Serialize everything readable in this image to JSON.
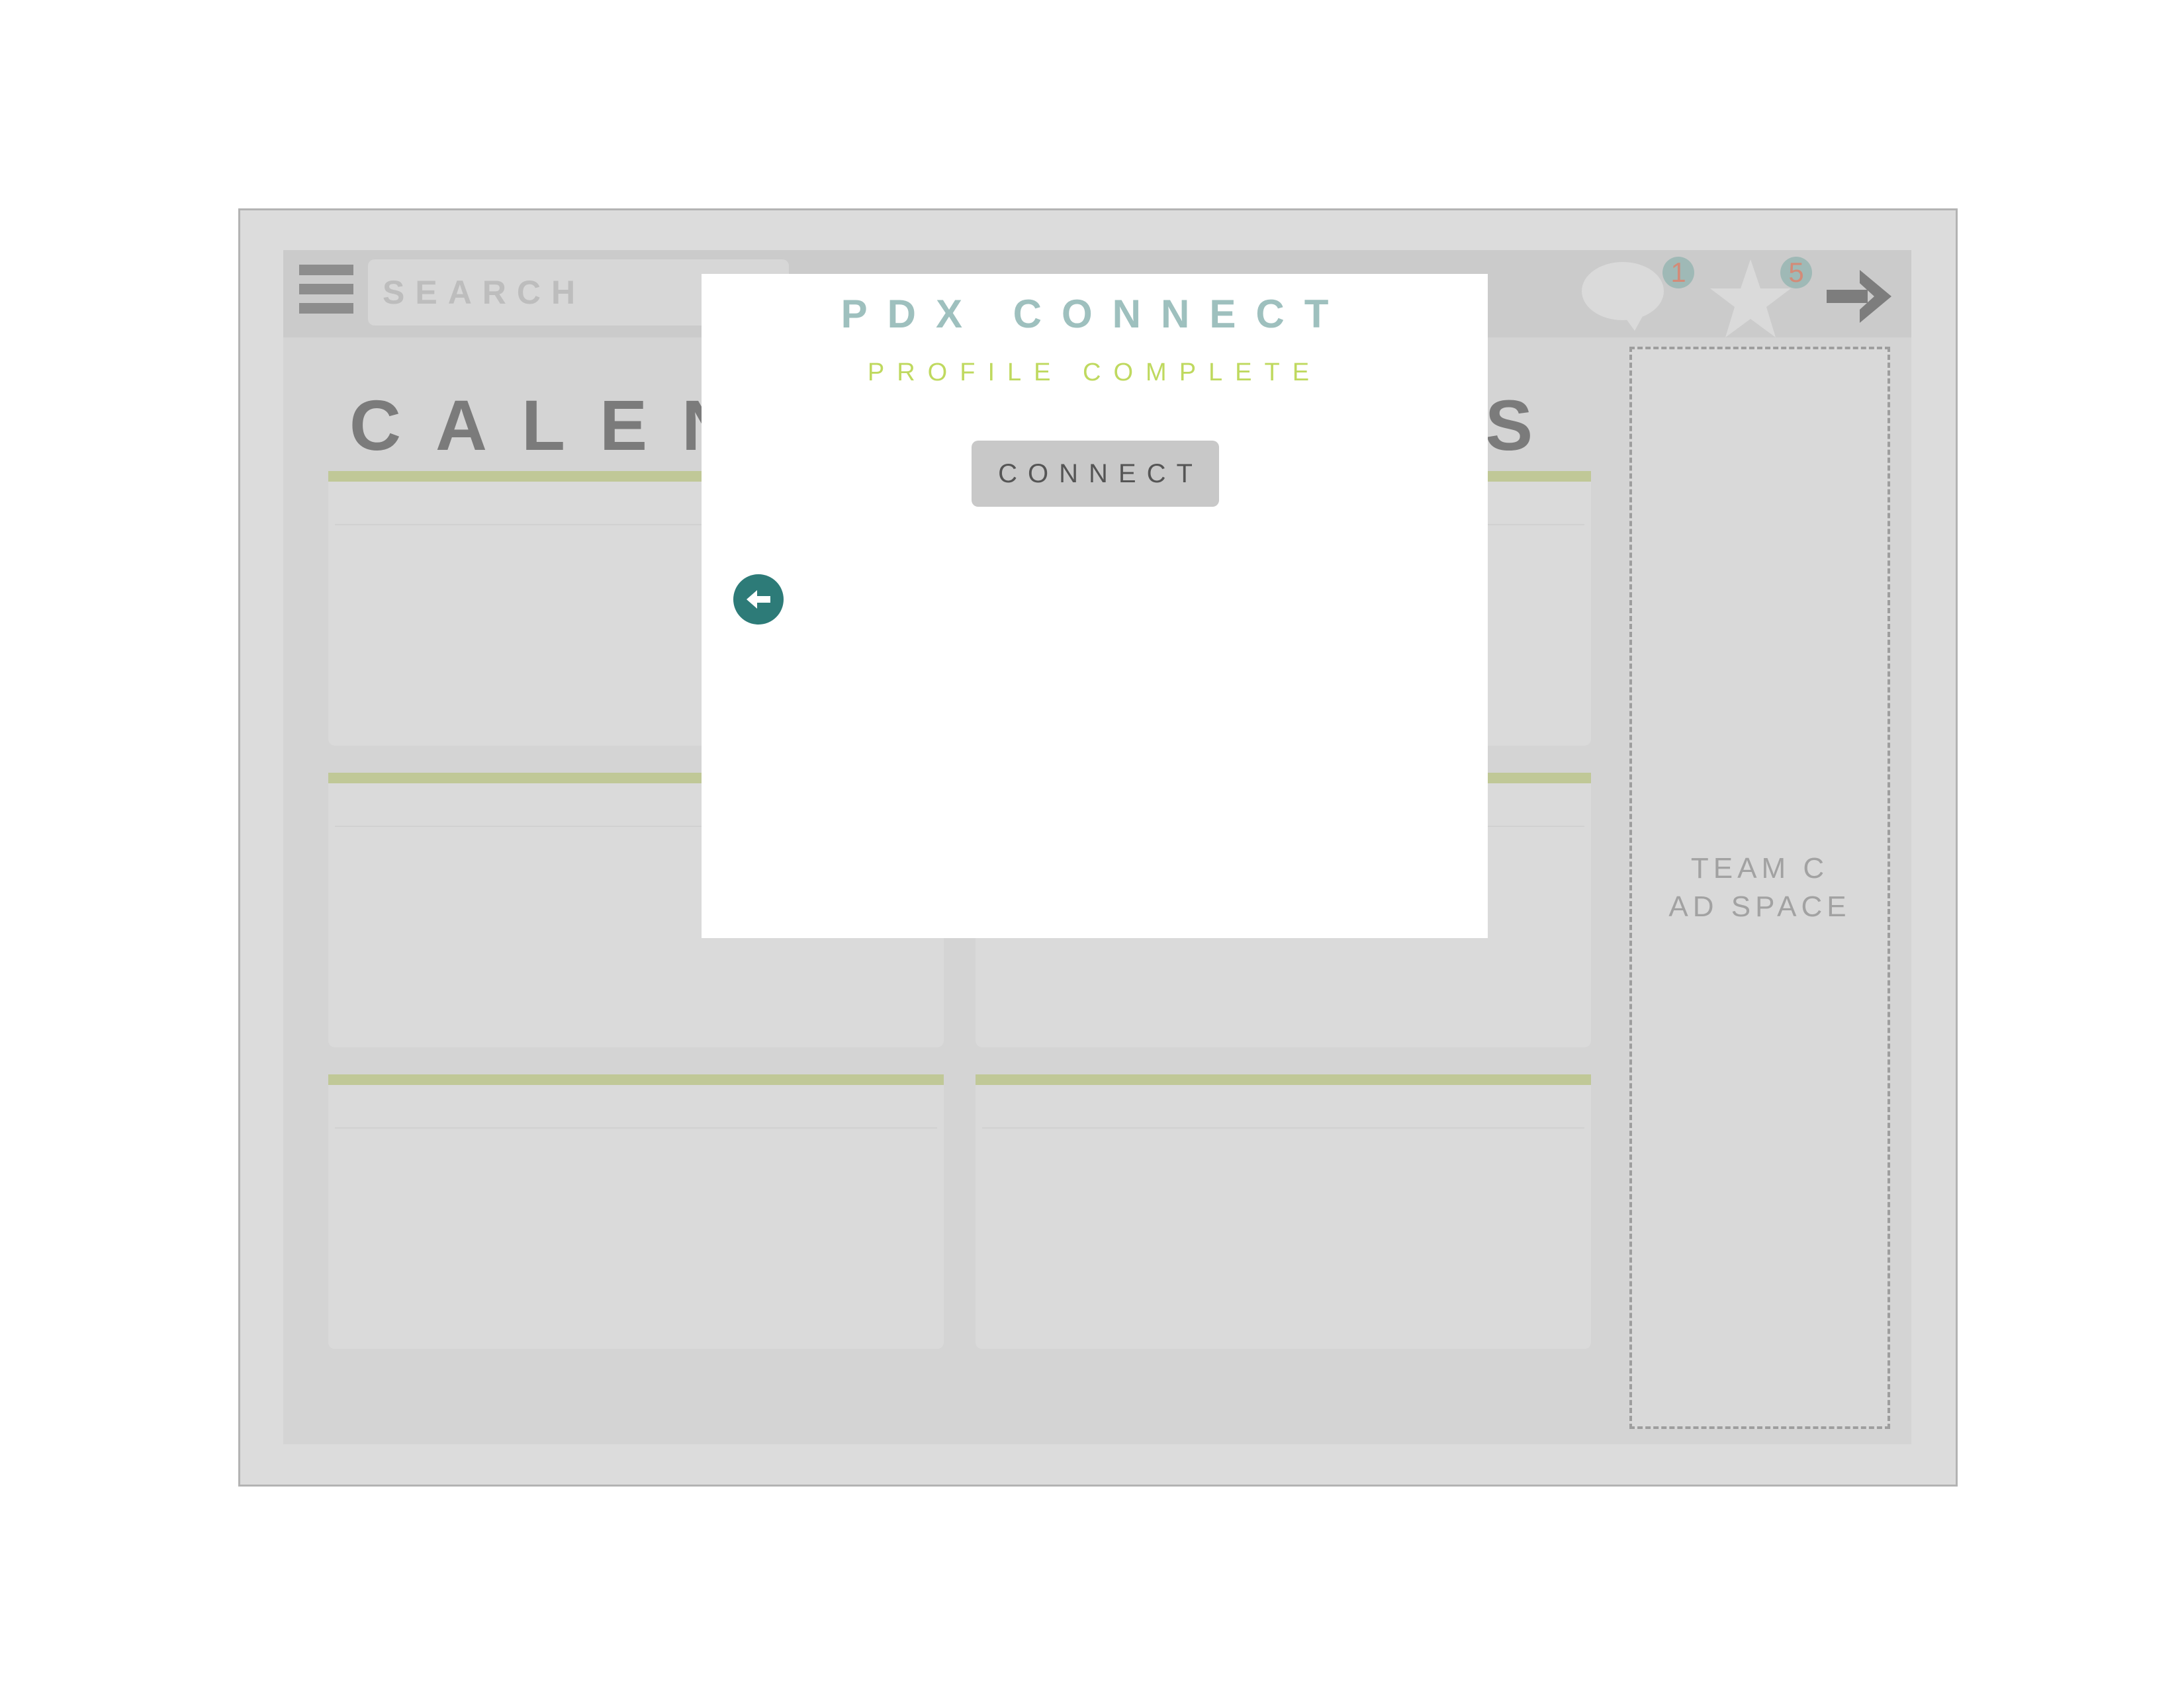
{
  "header": {
    "search_placeholder": "SEARCH",
    "messages_badge": "1",
    "favorites_badge": "5"
  },
  "page": {
    "heading_visible_start": "CALEN",
    "heading_visible_end": "S"
  },
  "ad_space": {
    "line1": "TEAM C",
    "line2": "AD SPACE"
  },
  "modal": {
    "title": "PDX CONNECT",
    "subtitle": "PROFILE COMPLETE",
    "connect_label": "CONNECT"
  },
  "icons": {
    "menu": "hamburger-menu-icon",
    "messages": "speech-bubble-icon",
    "favorites": "star-icon",
    "logout": "arrow-right-icon",
    "back": "arrow-left-circle-icon"
  },
  "colors": {
    "accent_teal": "#2d7b78",
    "title_teal": "#9ec0be",
    "subtitle_green": "#bfd95f",
    "card_stripe": "#c0c897",
    "badge_number": "#d38b78"
  }
}
